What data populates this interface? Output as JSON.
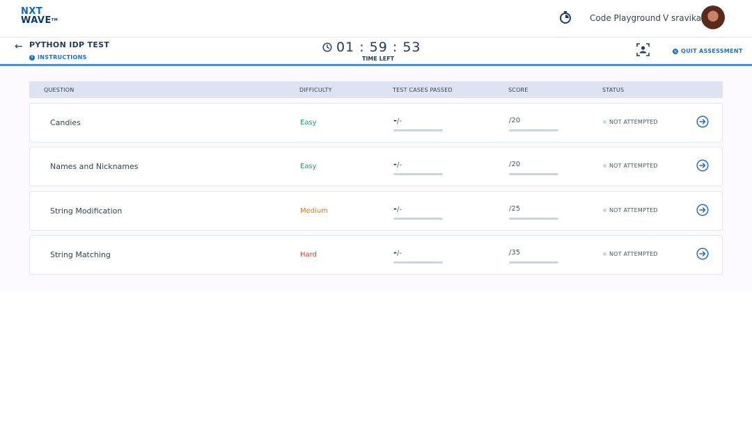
{
  "brand": {
    "line1": "NXT",
    "line2": "WAVE",
    "tm": "TM"
  },
  "header": {
    "code_playground": "Code Playground",
    "user_name": "V sravika"
  },
  "assessment": {
    "title": "PYTHON IDP TEST",
    "instructions_label": "INSTRUCTIONS",
    "timer": "01 : 59 : 53",
    "time_left_label": "TIME LEFT",
    "quit_label": "QUIT ASSESSMENT"
  },
  "table": {
    "headers": {
      "question": "QUESTION",
      "difficulty": "DIFFICULTY",
      "test_cases": "TEST CASES PASSED",
      "score": "SCORE",
      "status": "STATUS"
    },
    "rows": [
      {
        "title": "Candies",
        "difficulty": "Easy",
        "test_cases_passed": "-",
        "test_cases_total": "/-",
        "score": "/20",
        "status": "NOT ATTEMPTED",
        "progress": 0
      },
      {
        "title": "Names and Nicknames",
        "difficulty": "Easy",
        "test_cases_passed": "-",
        "test_cases_total": "/-",
        "score": "/20",
        "status": "NOT ATTEMPTED",
        "progress": 0
      },
      {
        "title": "String Modification",
        "difficulty": "Medium",
        "test_cases_passed": "-",
        "test_cases_total": "/-",
        "score": "/25",
        "status": "NOT ATTEMPTED",
        "progress": 0
      },
      {
        "title": "String Matching",
        "difficulty": "Hard",
        "test_cases_passed": "-",
        "test_cases_total": "/-",
        "score": "/35",
        "status": "NOT ATTEMPTED",
        "progress": 0
      }
    ]
  },
  "colors": {
    "easy": "#22a06b",
    "medium": "#e07a1f",
    "hard": "#d83a2c",
    "accent": "#1e6fc4"
  },
  "icons": {
    "stopwatch": "stopwatch-icon",
    "back": "arrow-left-icon",
    "info": "info-icon",
    "clock": "clock-icon",
    "face_scan": "face-scan-icon",
    "quit": "close-circle-icon",
    "go": "arrow-right-circle-icon"
  }
}
